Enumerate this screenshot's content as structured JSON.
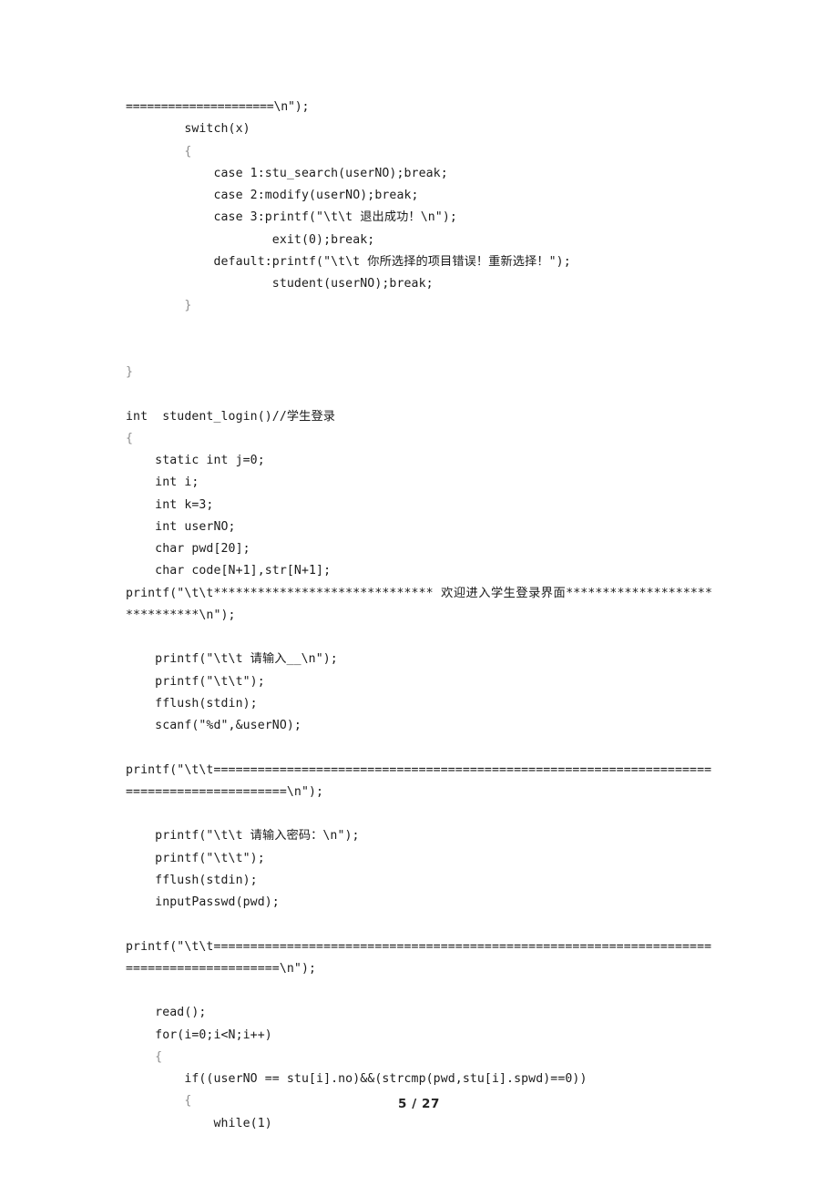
{
  "document": {
    "page_label": "5 / 27",
    "language": "c",
    "lines": [
      {
        "id": "l01",
        "text": "=====================\\n\");",
        "style": "sep"
      },
      {
        "id": "l02",
        "text": "        switch(x)"
      },
      {
        "id": "l03",
        "text": "        {"
      },
      {
        "id": "l04",
        "text": "            case 1:stu_search(userNO);break;"
      },
      {
        "id": "l05",
        "text": "            case 2:modify(userNO);break;"
      },
      {
        "id": "l06",
        "text": "            case 3:printf(\"\\t\\t 退出成功！\\n\");"
      },
      {
        "id": "l07",
        "text": "                    exit(0);break;"
      },
      {
        "id": "l08",
        "text": "            default:printf(\"\\t\\t 你所选择的项目错误！重新选择！\");"
      },
      {
        "id": "l09",
        "text": "                    student(userNO);break;"
      },
      {
        "id": "l10",
        "text": "        }"
      },
      {
        "id": "l11",
        "text": ""
      },
      {
        "id": "l12",
        "text": ""
      },
      {
        "id": "l13",
        "text": "}"
      },
      {
        "id": "l14",
        "text": ""
      },
      {
        "id": "l15",
        "text": "int  student_login()//学生登录"
      },
      {
        "id": "l16",
        "text": "{"
      },
      {
        "id": "l17",
        "text": "    static int j=0;"
      },
      {
        "id": "l18",
        "text": "    int i;"
      },
      {
        "id": "l19",
        "text": "    int k=3;"
      },
      {
        "id": "l20",
        "text": "    int userNO;"
      },
      {
        "id": "l21",
        "text": "    char pwd[20];"
      },
      {
        "id": "l22",
        "text": "    char code[N+1],str[N+1];"
      },
      {
        "id": "l23",
        "text": "    printf(\"\\t\\t****************************** 欢迎进入学生登录界面******************************\\n\");",
        "wrap": true
      },
      {
        "id": "l24",
        "text": "    printf(\"\\t\\t 请输入__\\n\");"
      },
      {
        "id": "l25",
        "text": "    printf(\"\\t\\t\");"
      },
      {
        "id": "l26",
        "text": "    fflush(stdin);"
      },
      {
        "id": "l27",
        "text": "    scanf(\"%d\",&userNO);"
      },
      {
        "id": "l28",
        "text": ""
      },
      {
        "id": "l29",
        "text": "printf(\"\\t\\t==========================================================================================\\n\");",
        "wrap": true
      },
      {
        "id": "l30",
        "text": "    printf(\"\\t\\t 请输入密码：\\n\");"
      },
      {
        "id": "l31",
        "text": "    printf(\"\\t\\t\");"
      },
      {
        "id": "l32",
        "text": "    fflush(stdin);"
      },
      {
        "id": "l33",
        "text": "    inputPasswd(pwd);"
      },
      {
        "id": "l34",
        "text": ""
      },
      {
        "id": "l35",
        "text": "printf(\"\\t\\t=========================================================================================\\n\");",
        "wrap": true
      },
      {
        "id": "l36",
        "text": "    read();"
      },
      {
        "id": "l37",
        "text": "    for(i=0;i<N;i++)"
      },
      {
        "id": "l38",
        "text": "    {"
      },
      {
        "id": "l39",
        "text": "        if((userNO == stu[i].no)&&(strcmp(pwd,stu[i].spwd)==0))"
      },
      {
        "id": "l40",
        "text": "        {"
      },
      {
        "id": "l41",
        "text": "            while(1)"
      }
    ]
  }
}
